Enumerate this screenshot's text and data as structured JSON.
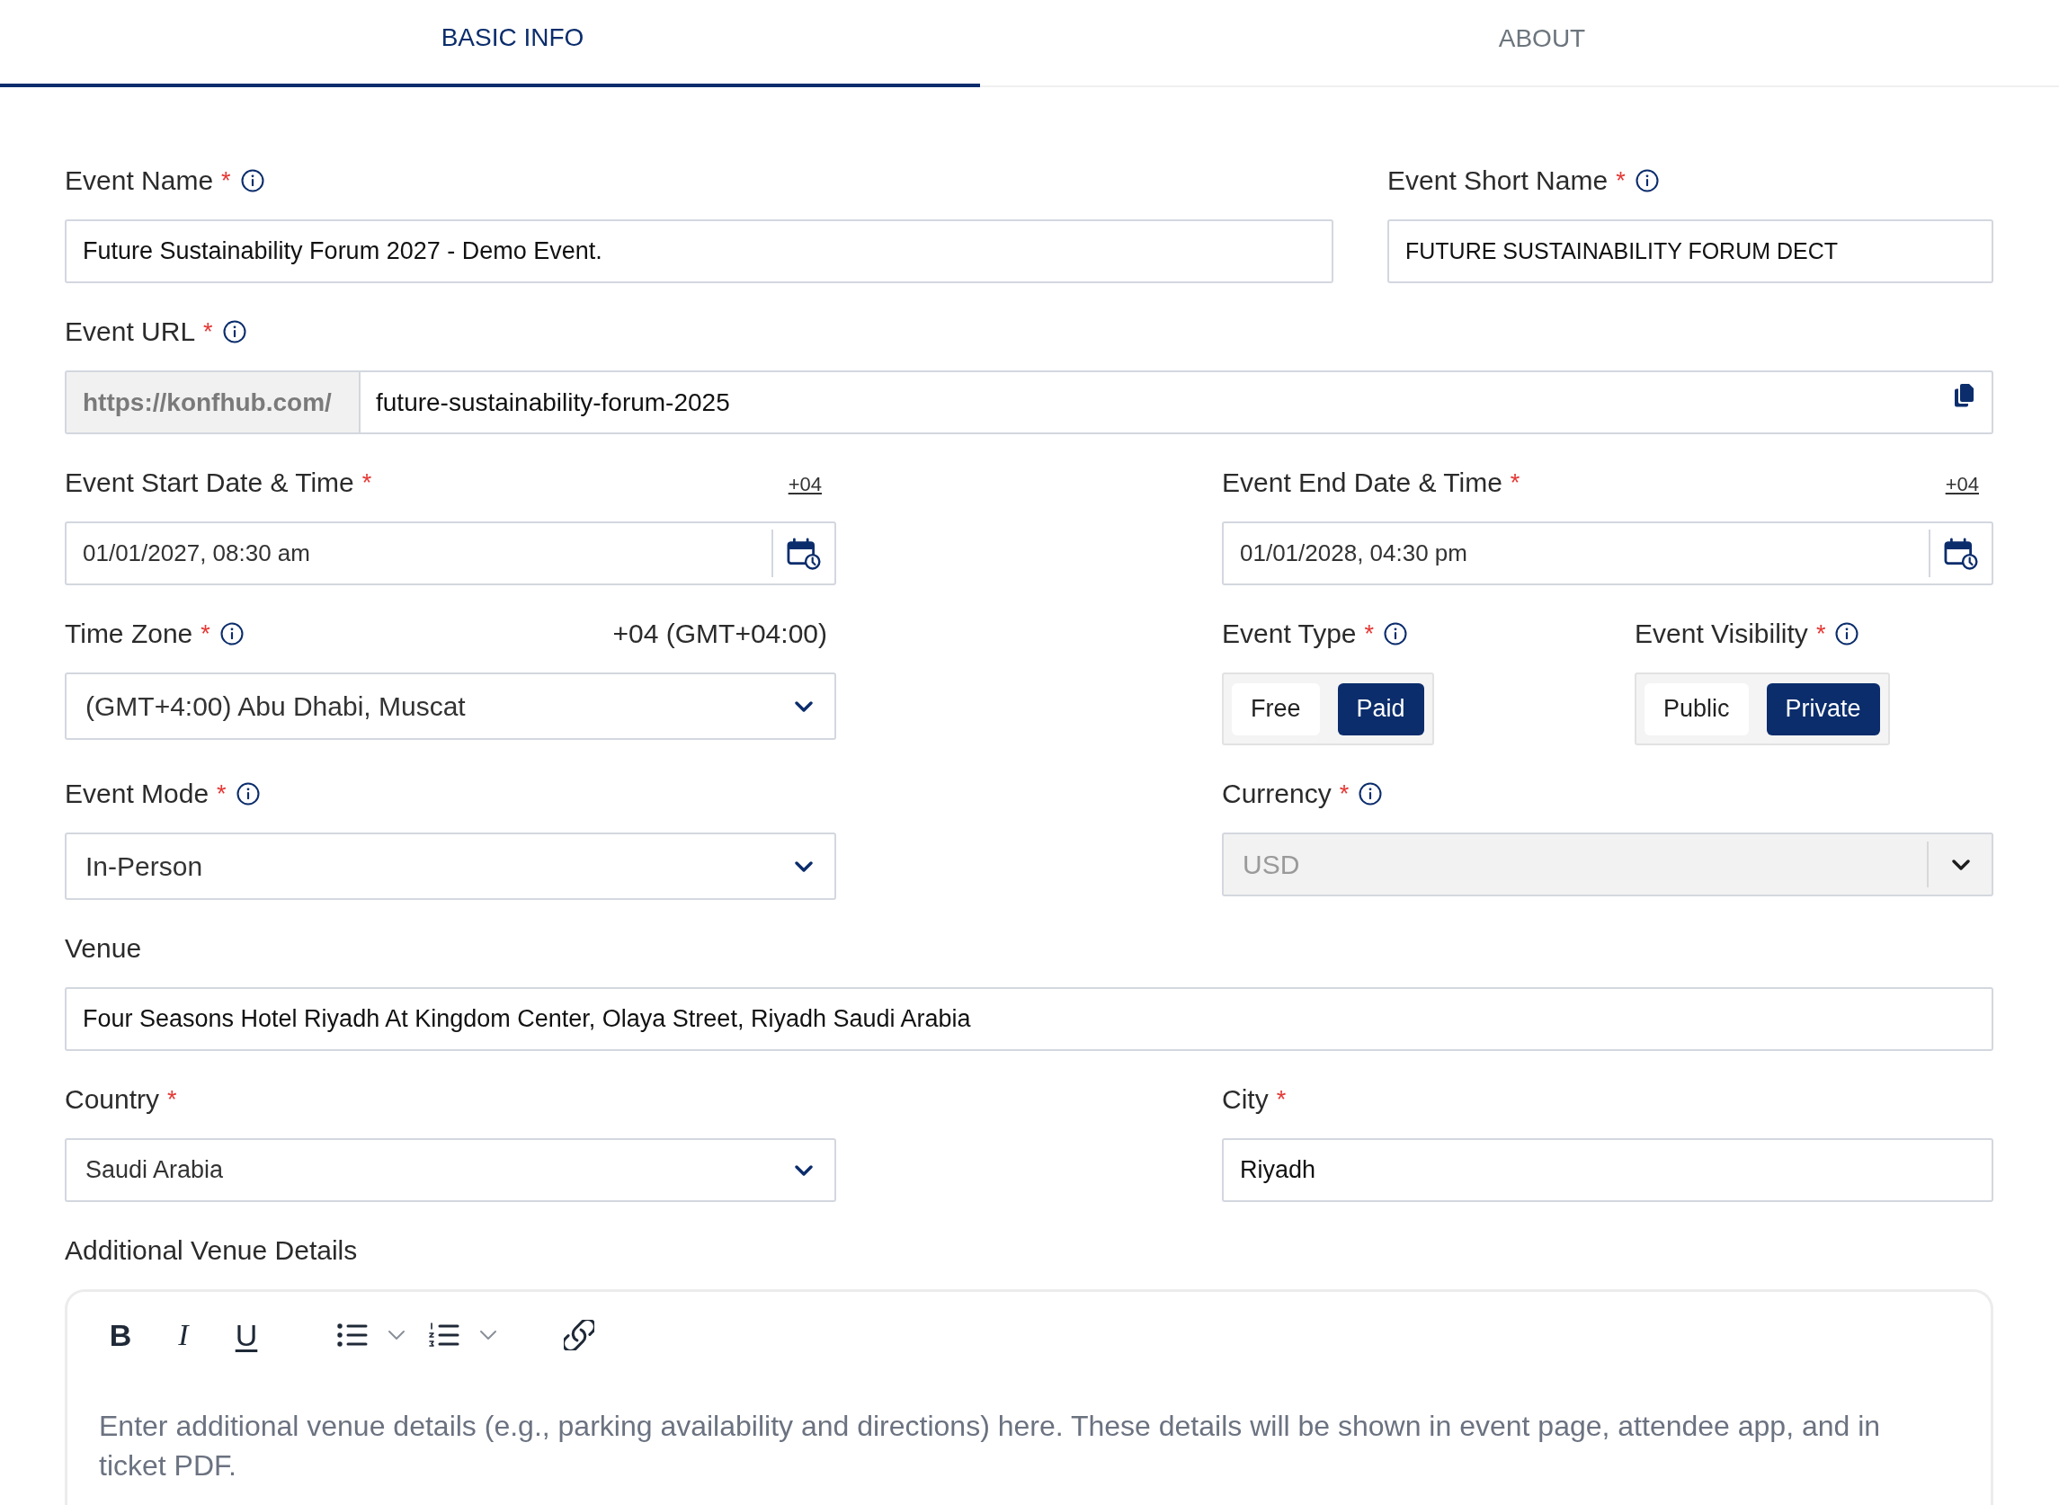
{
  "tabs": [
    {
      "label": "BASIC INFO",
      "selected": true
    },
    {
      "label": "ABOUT",
      "selected": false
    }
  ],
  "fields": [
    {
      "kind": "text",
      "label": "Event Name",
      "required_mark": "*",
      "info": true,
      "value": "Future Sustainability Forum 2027 - Demo Event."
    },
    {
      "kind": "text",
      "label": "Event Short Name",
      "required_mark": "*",
      "info": true,
      "value": "FUTURE SUSTAINABILITY FORUM DECT"
    },
    {
      "kind": "url",
      "label": "Event URL",
      "required_mark": "*",
      "info": true,
      "prefix": "https://konfhub.com/",
      "value": "future-sustainability-forum-2025"
    },
    {
      "kind": "datetime",
      "label": "Event Start Date & Time",
      "required_mark": "*",
      "timezone": "+04",
      "value": "01/01/2027, 08:30 am"
    },
    {
      "kind": "datetime",
      "label": "Event End Date & Time",
      "required_mark": "*",
      "timezone": "+04",
      "value": "01/01/2028, 04:30 pm"
    },
    {
      "kind": "select",
      "label": "Time Zone",
      "required_mark": "*",
      "info": true,
      "note": "+04 (GMT+04:00)",
      "value": "(GMT+4:00) Abu Dhabi, Muscat",
      "disabled": false
    },
    {
      "kind": "toggle",
      "label": "Event Type",
      "required_mark": "*",
      "info": true,
      "options": [
        {
          "label": "Free",
          "selected": false
        },
        {
          "label": "Paid",
          "selected": true
        }
      ]
    },
    {
      "kind": "toggle",
      "label": "Event Visibility",
      "required_mark": "*",
      "info": true,
      "options": [
        {
          "label": "Public",
          "selected": false
        },
        {
          "label": "Private",
          "selected": true
        }
      ]
    },
    {
      "kind": "select",
      "label": "Event Mode",
      "required_mark": "*",
      "info": true,
      "value": "In-Person",
      "disabled": false
    },
    {
      "kind": "select",
      "label": "Currency",
      "required_mark": "*",
      "info": true,
      "value": "USD",
      "disabled": true
    },
    {
      "kind": "text",
      "label": "Venue",
      "value": "Four Seasons Hotel Riyadh At Kingdom Center, Olaya Street, Riyadh Saudi Arabia"
    },
    {
      "kind": "select",
      "label": "Country",
      "required_mark": "*",
      "value": "Saudi Arabia",
      "disabled": false
    },
    {
      "kind": "text",
      "label": "City",
      "required_mark": "*",
      "value": "Riyadh"
    },
    {
      "kind": "editor",
      "label": "Additional Venue Details",
      "toolbar": [
        {
          "kind": "bold",
          "label": "B"
        },
        {
          "kind": "italic",
          "label": "I"
        },
        {
          "kind": "underline",
          "label": "U"
        },
        {
          "kind": "bullet_list"
        },
        {
          "kind": "numbered_list"
        },
        {
          "kind": "link"
        }
      ],
      "placeholder": "Enter additional venue details (e.g., parking availability and directions) here. These details will be shown in event page, attendee app, and in ticket PDF."
    }
  ]
}
